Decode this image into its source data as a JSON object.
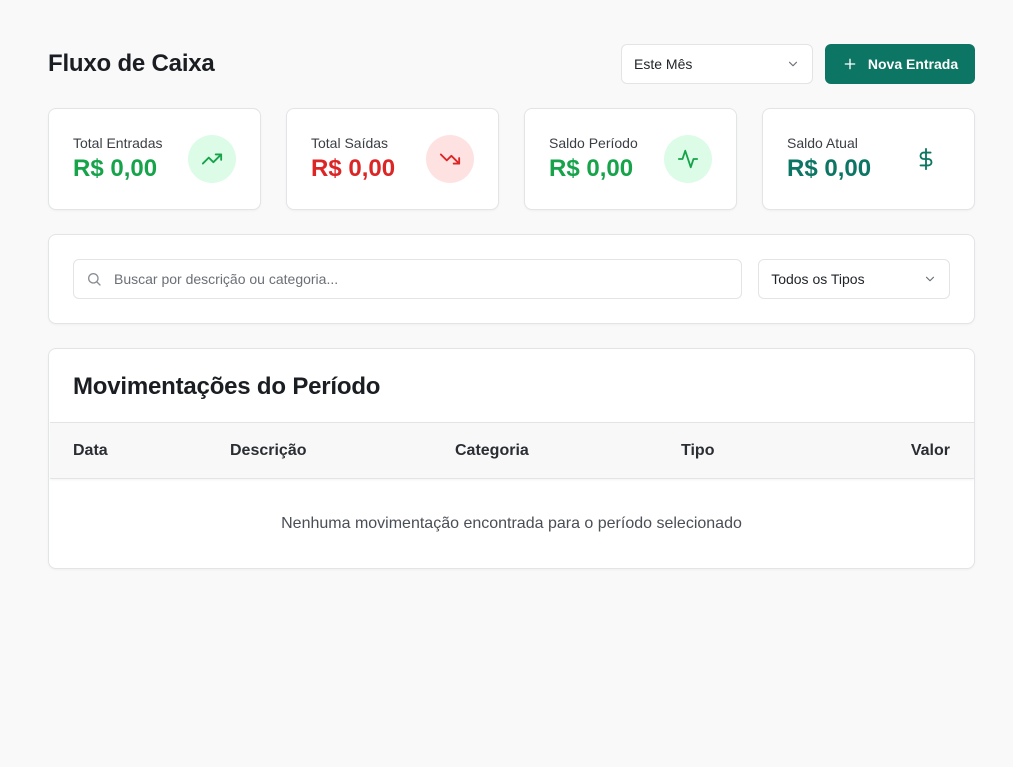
{
  "header": {
    "title": "Fluxo de Caixa",
    "period_select": {
      "value": "Este Mês",
      "icon": "chevron-down-icon"
    },
    "new_entry_button": {
      "label": "Nova Entrada",
      "icon": "plus-icon"
    }
  },
  "stats": [
    {
      "label": "Total Entradas",
      "value": "R$ 0,00",
      "icon": "trending-up-icon",
      "color": "#16a34a",
      "icon_bg": "#dcfce7"
    },
    {
      "label": "Total Saídas",
      "value": "R$ 0,00",
      "icon": "trending-down-icon",
      "color": "#dc2626",
      "icon_bg": "#fee2e2"
    },
    {
      "label": "Saldo Período",
      "value": "R$ 0,00",
      "icon": "activity-icon",
      "color": "#16a34a",
      "icon_bg": "#dcfce7"
    },
    {
      "label": "Saldo Atual",
      "value": "R$ 0,00",
      "icon": "dollar-sign-icon",
      "color": "#0d7563",
      "icon_bg": "#ffffff"
    }
  ],
  "filters": {
    "search": {
      "placeholder": "Buscar por descrição ou categoria...",
      "value": "",
      "icon": "search-icon"
    },
    "type_select": {
      "value": "Todos os Tipos",
      "icon": "chevron-down-icon"
    }
  },
  "table": {
    "title": "Movimentações do Período",
    "columns": [
      "Data",
      "Descrição",
      "Categoria",
      "Tipo",
      "Valor"
    ],
    "rows": [],
    "empty_message": "Nenhuma movimentação encontrada para o período selecionado"
  },
  "colors": {
    "brand": "#0d7563",
    "positive": "#16a34a",
    "negative": "#dc2626",
    "background": "#f9f9f9"
  }
}
